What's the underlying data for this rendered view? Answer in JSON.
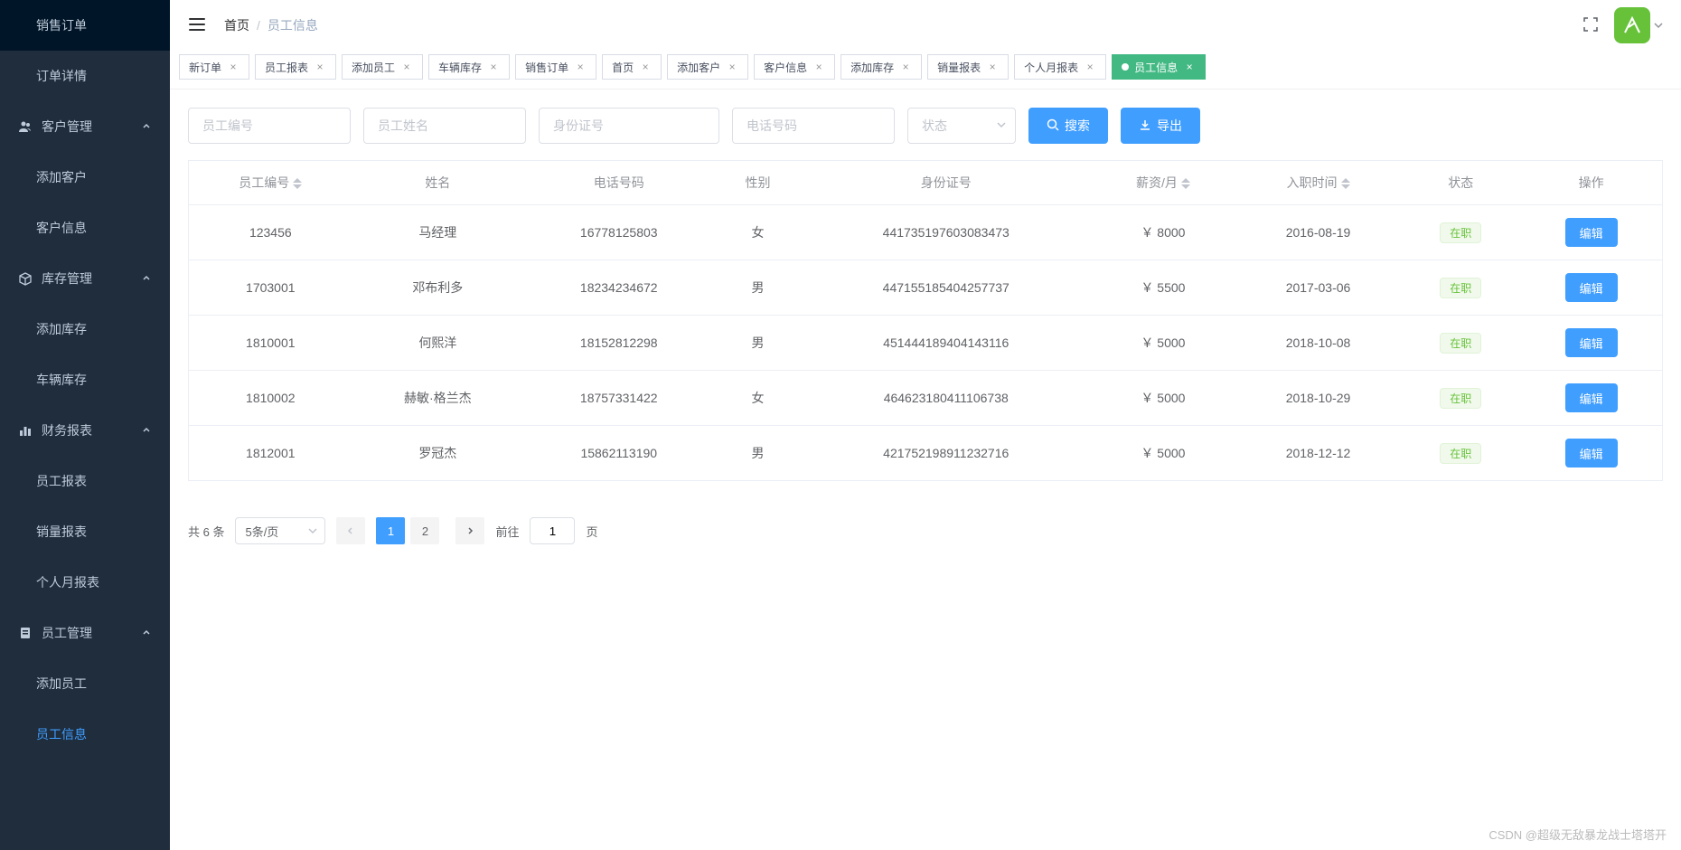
{
  "breadcrumb": {
    "home": "首页",
    "current": "员工信息"
  },
  "sidebar": {
    "groups": [
      {
        "label": "销售订单",
        "icon": "",
        "type": "sub"
      },
      {
        "label": "订单详情",
        "icon": "",
        "type": "sub"
      },
      {
        "label": "客户管理",
        "icon": "users",
        "type": "group"
      },
      {
        "label": "添加客户",
        "icon": "",
        "type": "sub"
      },
      {
        "label": "客户信息",
        "icon": "",
        "type": "sub"
      },
      {
        "label": "库存管理",
        "icon": "box",
        "type": "group"
      },
      {
        "label": "添加库存",
        "icon": "",
        "type": "sub"
      },
      {
        "label": "车辆库存",
        "icon": "",
        "type": "sub"
      },
      {
        "label": "财务报表",
        "icon": "chart",
        "type": "group"
      },
      {
        "label": "员工报表",
        "icon": "",
        "type": "sub"
      },
      {
        "label": "销量报表",
        "icon": "",
        "type": "sub"
      },
      {
        "label": "个人月报表",
        "icon": "",
        "type": "sub"
      },
      {
        "label": "员工管理",
        "icon": "badge",
        "type": "group"
      },
      {
        "label": "添加员工",
        "icon": "",
        "type": "sub"
      },
      {
        "label": "员工信息",
        "icon": "",
        "type": "sub",
        "active": true
      }
    ]
  },
  "tabs": [
    {
      "label": "新订单"
    },
    {
      "label": "员工报表"
    },
    {
      "label": "添加员工"
    },
    {
      "label": "车辆库存"
    },
    {
      "label": "销售订单"
    },
    {
      "label": "首页"
    },
    {
      "label": "添加客户"
    },
    {
      "label": "客户信息"
    },
    {
      "label": "添加库存"
    },
    {
      "label": "销量报表"
    },
    {
      "label": "个人月报表"
    },
    {
      "label": "员工信息",
      "active": true
    }
  ],
  "filters": {
    "emp_no_placeholder": "员工编号",
    "emp_name_placeholder": "员工姓名",
    "id_placeholder": "身份证号",
    "phone_placeholder": "电话号码",
    "status_placeholder": "状态",
    "search_label": "搜索",
    "export_label": "导出"
  },
  "table": {
    "headers": {
      "emp_no": "员工编号",
      "name": "姓名",
      "phone": "电话号码",
      "gender": "性别",
      "id_no": "身份证号",
      "salary": "薪资/月",
      "hire_date": "入职时间",
      "status": "状态",
      "action": "操作"
    },
    "edit_label": "编辑",
    "rows": [
      {
        "emp_no": "123456",
        "name": "马经理",
        "phone": "16778125803",
        "gender": "女",
        "id_no": "441735197603083473",
        "salary": "￥ 8000",
        "hire_date": "2016-08-19",
        "status": "在职"
      },
      {
        "emp_no": "1703001",
        "name": "邓布利多",
        "phone": "18234234672",
        "gender": "男",
        "id_no": "447155185404257737",
        "salary": "￥ 5500",
        "hire_date": "2017-03-06",
        "status": "在职"
      },
      {
        "emp_no": "1810001",
        "name": "何熙洋",
        "phone": "18152812298",
        "gender": "男",
        "id_no": "451444189404143116",
        "salary": "￥ 5000",
        "hire_date": "2018-10-08",
        "status": "在职"
      },
      {
        "emp_no": "1810002",
        "name": "赫敏·格兰杰",
        "phone": "18757331422",
        "gender": "女",
        "id_no": "464623180411106738",
        "salary": "￥ 5000",
        "hire_date": "2018-10-29",
        "status": "在职"
      },
      {
        "emp_no": "1812001",
        "name": "罗冠杰",
        "phone": "15862113190",
        "gender": "男",
        "id_no": "421752198911232716",
        "salary": "￥ 5000",
        "hire_date": "2018-12-12",
        "status": "在职"
      }
    ]
  },
  "pagination": {
    "total_text": "共 6 条",
    "page_size_label": "5条/页",
    "pages": [
      "1",
      "2"
    ],
    "current": "1",
    "goto_prefix": "前往",
    "goto_suffix": "页",
    "goto_value": "1"
  },
  "watermark": "CSDN @超级无敌暴龙战士塔塔开"
}
